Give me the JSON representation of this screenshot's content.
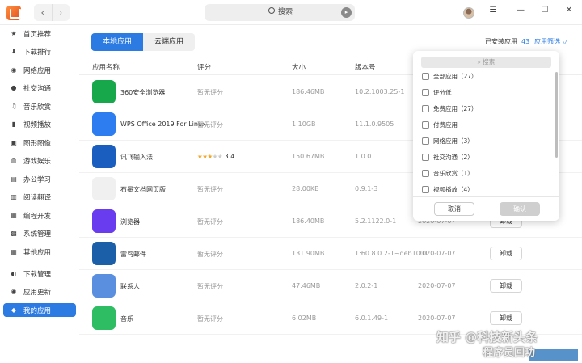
{
  "window": {
    "search_placeholder": "搜索"
  },
  "sidebar": {
    "items": [
      {
        "label": "首页推荐",
        "icon": "star-icon"
      },
      {
        "label": "下载排行",
        "icon": "download-icon"
      },
      {
        "label": "网络应用",
        "icon": "globe-icon"
      },
      {
        "label": "社交沟通",
        "icon": "chat-icon"
      },
      {
        "label": "音乐欣赏",
        "icon": "music-icon"
      },
      {
        "label": "视频播放",
        "icon": "video-icon"
      },
      {
        "label": "图形图像",
        "icon": "image-icon"
      },
      {
        "label": "游戏娱乐",
        "icon": "gamepad-icon"
      },
      {
        "label": "办公学习",
        "icon": "office-icon"
      },
      {
        "label": "阅读翻译",
        "icon": "book-icon"
      },
      {
        "label": "编程开发",
        "icon": "code-icon"
      },
      {
        "label": "系统管理",
        "icon": "gear-icon"
      },
      {
        "label": "其他应用",
        "icon": "grid-icon"
      }
    ],
    "bottom_items": [
      {
        "label": "下载管理",
        "icon": "download-manage-icon"
      },
      {
        "label": "应用更新",
        "icon": "update-icon"
      },
      {
        "label": "我的应用",
        "icon": "my-apps-icon"
      }
    ]
  },
  "tabs": {
    "local": "本地应用",
    "cloud": "云端应用"
  },
  "installed_label": "已安装应用",
  "installed_count": "43",
  "filter_label": "应用筛选",
  "columns": {
    "name": "应用名称",
    "rating": "评分",
    "size": "大小",
    "version": "版本号"
  },
  "apps": [
    {
      "name": "360安全浏览器",
      "rating": "暂无评分",
      "size": "186.46MB",
      "version": "10.2.1003.25-1",
      "date": "",
      "action": "",
      "icon_color": "#16a84a"
    },
    {
      "name": "WPS Office 2019 For Linux",
      "rating": "暂无评分",
      "size": "1.10GB",
      "version": "11.1.0.9505",
      "date": "",
      "action": "",
      "icon_color": "#2d7df0"
    },
    {
      "name": "讯飞输入法",
      "rating": "3.4",
      "stars": 3.4,
      "size": "150.67MB",
      "version": "1.0.0",
      "date": "",
      "action": "",
      "icon_color": "#1a5fbf"
    },
    {
      "name": "石墨文档网页版",
      "rating": "暂无评分",
      "size": "28.00KB",
      "version": "0.9.1-3",
      "date": "",
      "action": "",
      "icon_color": "#f0f0f0"
    },
    {
      "name": "浏览器",
      "rating": "暂无评分",
      "size": "186.40MB",
      "version": "5.2.1122.0-1",
      "date": "2020-07-07",
      "action": "卸载",
      "icon_color": "#6a3cf0"
    },
    {
      "name": "雷鸟邮件",
      "rating": "暂无评分",
      "size": "131.90MB",
      "version": "1:60.8.0.2-1~deb10u1",
      "date": "2020-07-07",
      "action": "卸载",
      "icon_color": "#1b5fa8"
    },
    {
      "name": "联系人",
      "rating": "暂无评分",
      "size": "47.46MB",
      "version": "2.0.2-1",
      "date": "2020-07-07",
      "action": "卸载",
      "icon_color": "#5a8fe0"
    },
    {
      "name": "音乐",
      "rating": "暂无评分",
      "size": "6.02MB",
      "version": "6.0.1.49-1",
      "date": "2020-07-07",
      "action": "卸载",
      "icon_color": "#2fbd63"
    }
  ],
  "filter_popup": {
    "search_placeholder": "搜索",
    "options": [
      {
        "label": "全部应用",
        "count": "（27）"
      },
      {
        "label": "评分低",
        "count": ""
      },
      {
        "label": "免费应用",
        "count": "（27）"
      },
      {
        "label": "付费应用",
        "count": ""
      },
      {
        "label": "网络应用",
        "count": "（3）"
      },
      {
        "label": "社交沟通",
        "count": "（2）"
      },
      {
        "label": "音乐欣赏",
        "count": "（1）"
      },
      {
        "label": "视频播放",
        "count": "（4）"
      }
    ],
    "cancel_label": "取消",
    "ok_label": "确认"
  },
  "watermark": {
    "line1": "知乎 @科技新头条",
    "line2": "程序员回功"
  }
}
